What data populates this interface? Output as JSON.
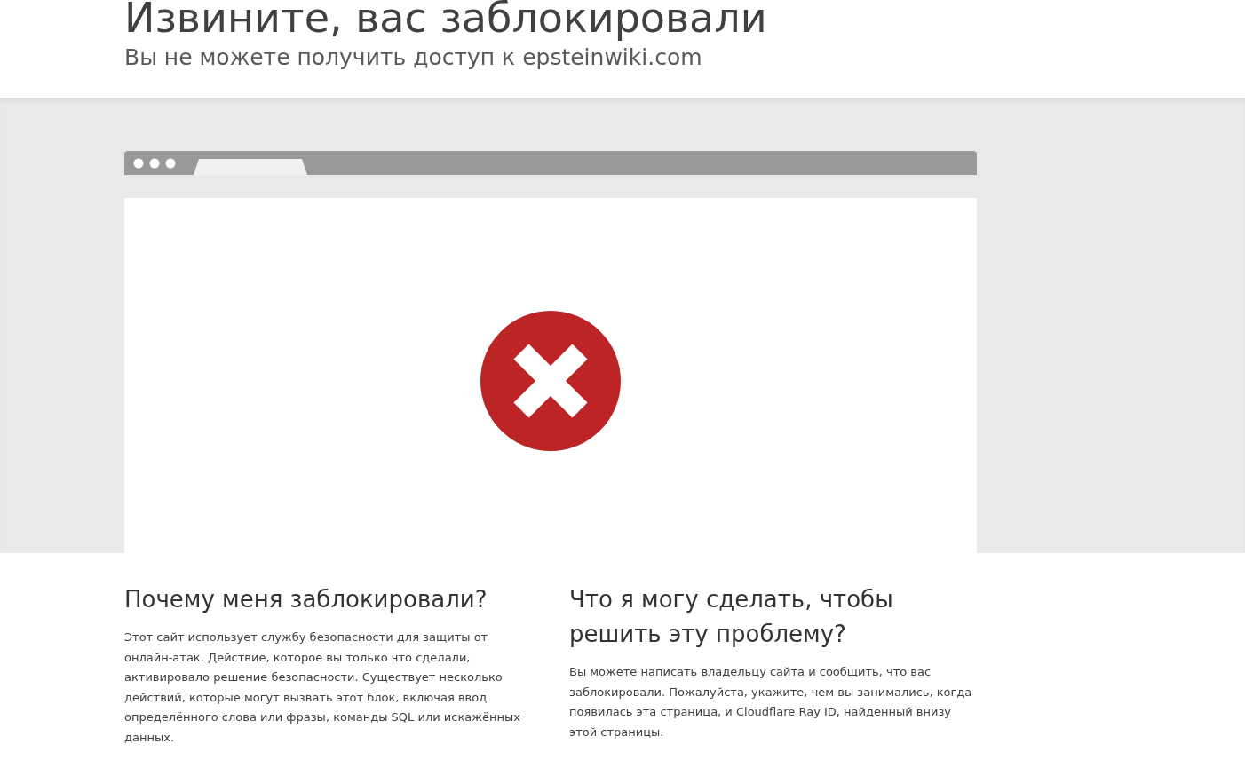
{
  "header": {
    "title": "Извините, вас заблокировали",
    "subtitle": "Вы не можете получить доступ к epsteinwiki.com"
  },
  "sections": [
    {
      "heading": "Почему меня заблокировали?",
      "text": "Этот сайт использует службу безопасности для защиты от онлайн-атак. Действие, которое вы только что сделали, активировало решение безопасности. Существует несколько действий, которые могут вызвать этот блок, включая ввод определённого слова или фразы, команды SQL или искажённых данных."
    },
    {
      "heading": "Что я могу сделать, чтобы решить эту проблему?",
      "text": "Вы можете написать владельцу сайта и сообщить, что вас заблокировали. Пожалуйста, укажите, чем вы занимались, когда появилась эта страница, и Cloudflare Ray ID, найденный внизу этой страницы."
    }
  ]
}
